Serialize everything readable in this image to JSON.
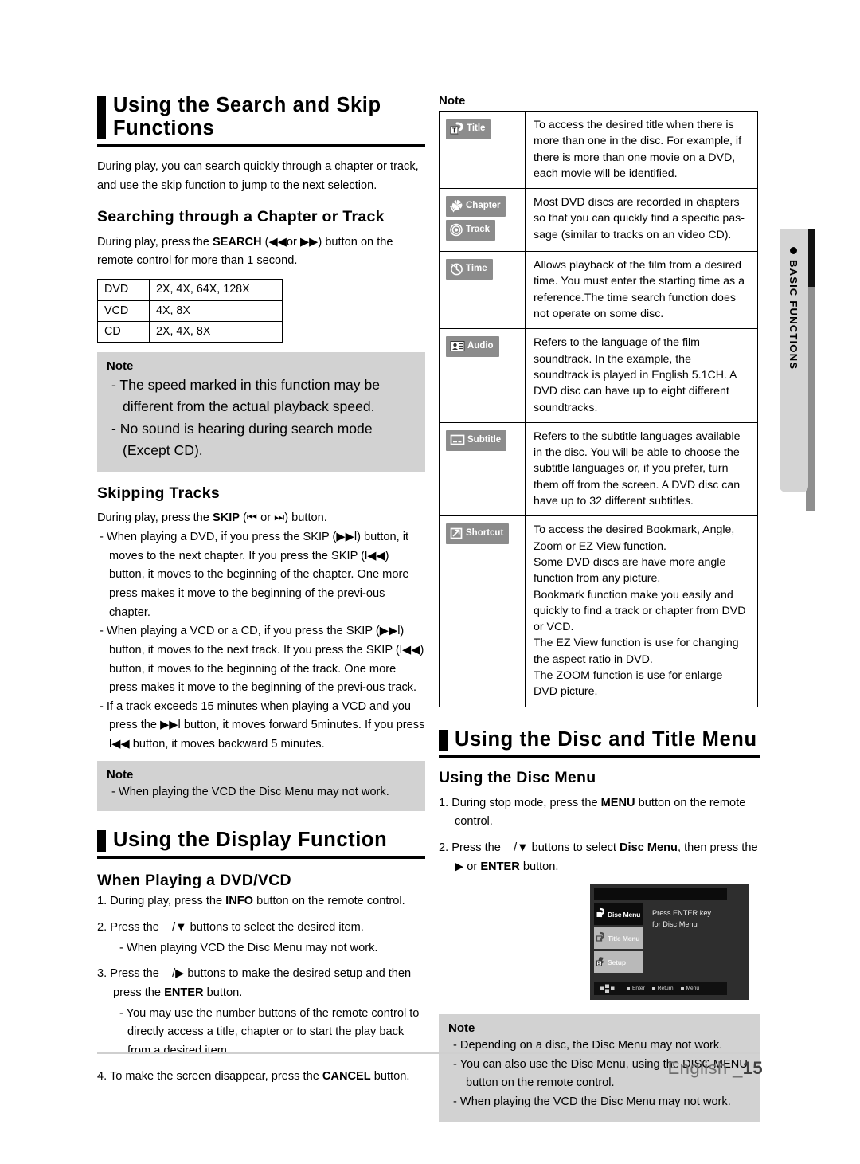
{
  "left": {
    "h1": "Using the Search and Skip Functions",
    "intro": "During play, you can search quickly through a chapter or track, and use the skip function to jump to the next selection.",
    "h2_search": "Searching through a Chapter or Track",
    "search_p_1": "During play, press the ",
    "search_p_bold": "SEARCH",
    "search_p_2": " (◀◀or ▶▶) button on the remote control for more than 1 second.",
    "spec_table": [
      {
        "disc": "DVD",
        "speeds": "2X, 4X, 64X, 128X"
      },
      {
        "disc": "VCD",
        "speeds": "4X, 8X"
      },
      {
        "disc": "CD",
        "speeds": "2X, 4X, 8X"
      }
    ],
    "note1_title": "Note",
    "note1_items": [
      "- The speed marked in this function may be different from the actual playback speed.",
      "- No sound is hearing during search mode (Except CD)."
    ],
    "h2_skip": "Skipping Tracks",
    "skip_p_1": "During play, press the ",
    "skip_p_bold": "SKIP",
    "skip_p_2": " (⏮ or ⏭) button.",
    "skip_items": [
      "- When playing a DVD, if you press the SKIP (▶▶l) button, it moves to the next chapter. If you press the SKIP (l◀◀) button, it moves to the beginning of the chapter. One more press makes it move to the beginning of the previ-ous chapter.",
      "- When playing a VCD or a CD, if you press the SKIP (▶▶l) button, it moves to the next track. If you press the SKIP (l◀◀) button, it moves to the beginning of the track. One more press makes it move to the beginning of the previ-ous track.",
      "- If a track exceeds 15 minutes when playing a VCD and you press the ▶▶l button, it moves forward 5minutes. If you press  l◀◀ button, it moves backward 5 minutes."
    ],
    "note2_title": "Note",
    "note2_items": [
      "-   When playing the VCD the Disc Menu may not work."
    ],
    "h1_display": "Using the Display Function",
    "h2_dvdvcd": "When Playing a DVD/VCD",
    "display_steps": [
      {
        "num": "1.",
        "text": "During play, press the INFO button on the remote control.",
        "bold": "INFO"
      },
      {
        "num": "2.",
        "text": "Press the    /▼ buttons to select the desired item.",
        "sub": "- When playing VCD the Disc Menu may not work."
      },
      {
        "num": "3.",
        "text": "Press the    /▶ buttons to make the desired setup and then press the ENTER button.",
        "bold": "ENTER",
        "sub": "- You may use the number buttons of the remote control to directly access a title, chapter or to start the play back from a desired item."
      },
      {
        "num": "4.",
        "text": "To make the screen disappear, press the CANCEL button.",
        "bold": "CANCEL"
      }
    ]
  },
  "right": {
    "note_label": "Note",
    "icon_rows": [
      {
        "badges": [
          {
            "label": "Title",
            "icon": "title-icon"
          }
        ],
        "text": "To access the desired title when there is more than one in the disc. For example, if there is more than one movie on a DVD, each movie will be identified."
      },
      {
        "badges": [
          {
            "label": "Chapter",
            "icon": "chapter-icon"
          },
          {
            "label": "Track",
            "icon": "track-icon"
          }
        ],
        "text": "Most DVD discs are recorded in chapters so that you can quickly find a specific pas-sage (similar to tracks on an video CD)."
      },
      {
        "badges": [
          {
            "label": "Time",
            "icon": "time-icon"
          }
        ],
        "text": "Allows playback of the film from a desired time. You must enter the starting time as a reference.The time search function does not operate on some disc."
      },
      {
        "badges": [
          {
            "label": "Audio",
            "icon": "audio-icon"
          }
        ],
        "text": "Refers to the language of the film soundtrack. In the example, the soundtrack is played in English 5.1CH. A DVD disc can have up to eight different soundtracks."
      },
      {
        "badges": [
          {
            "label": "Subtitle",
            "icon": "subtitle-icon"
          }
        ],
        "text": "Refers to the subtitle languages available in the disc. You will be able to choose the subtitle languages or, if you prefer, turn them off from the screen. A DVD disc can have up to 32 different subtitles."
      },
      {
        "badges": [
          {
            "label": "Shortcut",
            "icon": "shortcut-icon"
          }
        ],
        "text": "To access the desired Bookmark, Angle, Zoom or EZ View function.\nSome DVD discs are have more angle function from any picture.\nBookmark function make you easily and quickly to find a track or chapter from DVD or VCD.\nThe EZ View function is use for changing the aspect ratio in DVD.\nThe ZOOM function is use for enlarge DVD picture."
      }
    ],
    "h1_menu": "Using the Disc and Title Menu",
    "h2_discmenu": "Using the Disc Menu",
    "menu_steps": [
      {
        "num": "1.",
        "text": "During stop mode, press the MENU button on the remote control.",
        "bold": "MENU"
      },
      {
        "num": "2.",
        "text": "Press the    /▼ buttons to select Disc Menu, then press the ▶ or ENTER button.",
        "bold": "Disc Menu"
      }
    ],
    "tv": {
      "items": [
        {
          "label": "Disc Menu",
          "state": "selected"
        },
        {
          "label": "Title Menu",
          "state": "unselected"
        },
        {
          "label": "Setup",
          "state": "unselected"
        }
      ],
      "message": "Press ENTER key\nfor Disc Menu",
      "bottom": [
        "Enter",
        "Return",
        "Menu"
      ]
    },
    "note3_title": "Note",
    "note3_items": [
      "-   Depending on a disc, the Disc Menu may not work.",
      "-   You can also use the Disc Menu, using the DISC MENU button on the remote control.",
      "-   When playing the VCD the Disc Menu may not work."
    ]
  },
  "sidetab": {
    "label": "BASIC FUNCTIONS"
  },
  "footer": {
    "language": "English _",
    "page": "15"
  }
}
